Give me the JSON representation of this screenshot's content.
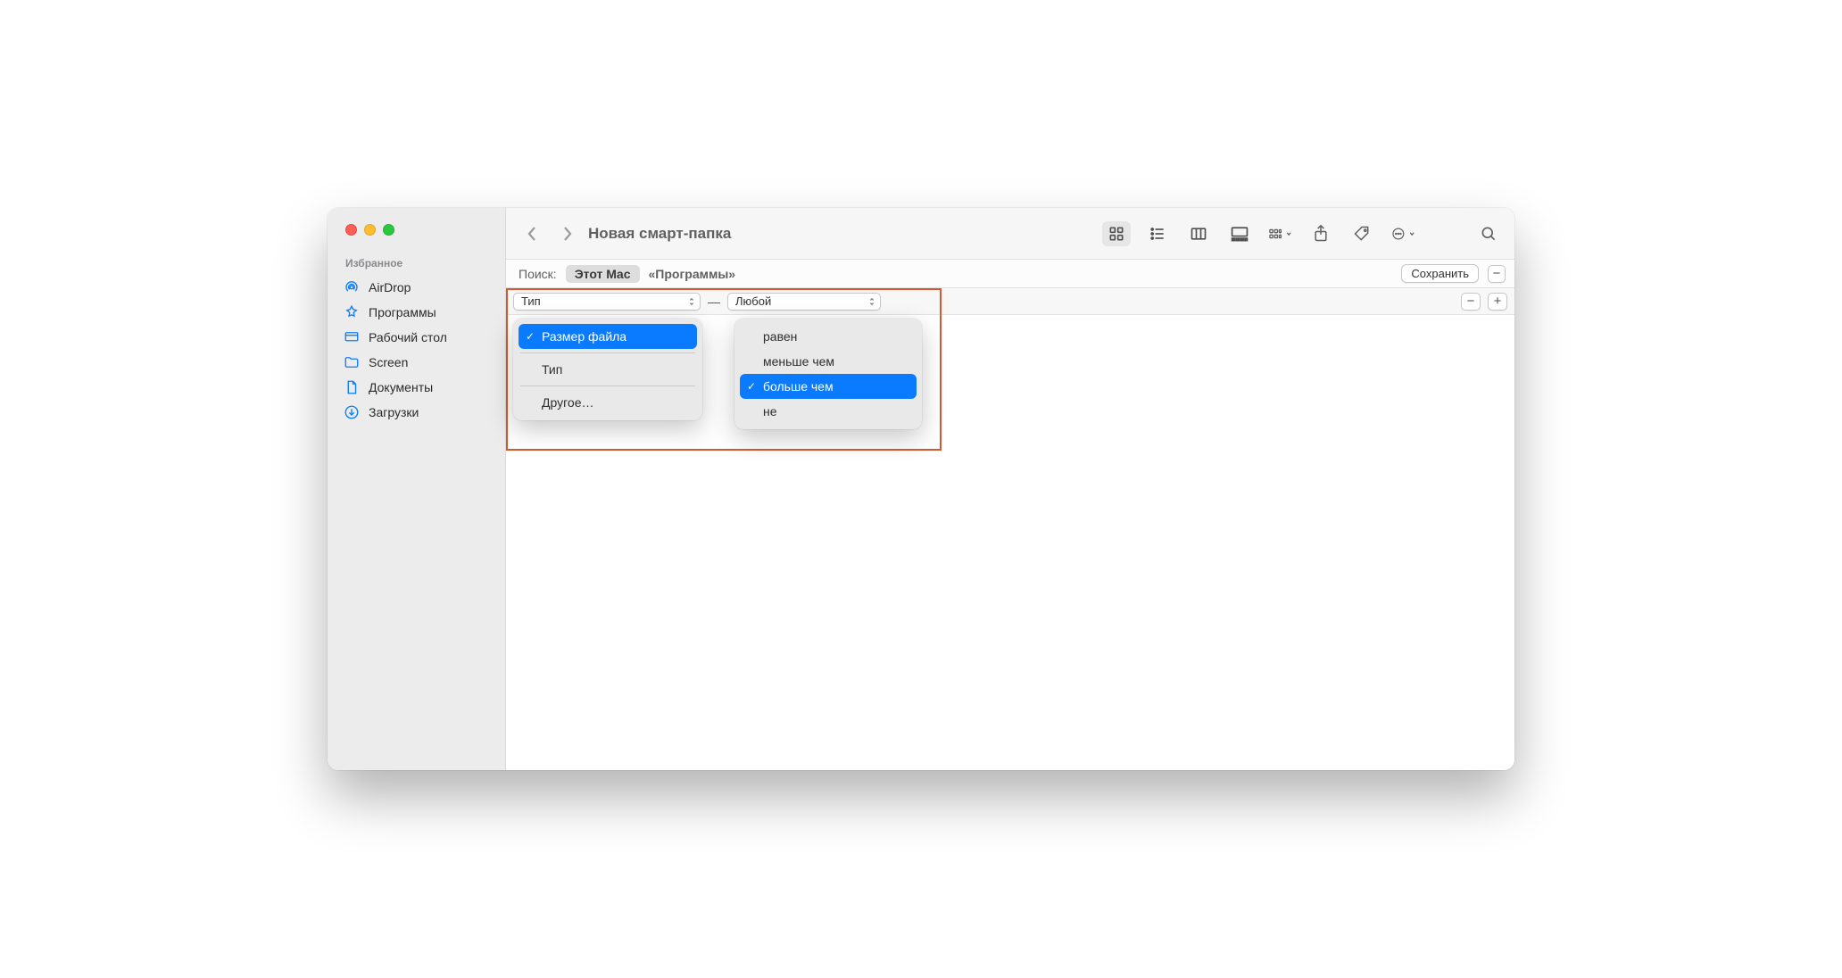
{
  "window": {
    "title": "Новая смарт-папка"
  },
  "sidebar": {
    "section": "Избранное",
    "items": [
      {
        "label": "AirDrop"
      },
      {
        "label": "Программы"
      },
      {
        "label": "Рабочий стол"
      },
      {
        "label": "Screen"
      },
      {
        "label": "Документы"
      },
      {
        "label": "Загрузки"
      }
    ]
  },
  "search": {
    "label": "Поиск:",
    "scope_active": "Этот Mac",
    "scope_alt": "«Программы»",
    "save": "Сохранить",
    "remove_symbol": "−"
  },
  "rule": {
    "kind_value": "Тип",
    "dash": "—",
    "any_value": "Любой",
    "minus": "−",
    "plus": "+"
  },
  "popover_kind": {
    "items": [
      {
        "label": "Размер файла",
        "selected": true
      },
      {
        "label": "Тип",
        "sep_before": true
      },
      {
        "label": "Другое…",
        "sep_before": true
      }
    ]
  },
  "popover_cmp": {
    "items": [
      {
        "label": "равен"
      },
      {
        "label": "меньше чем"
      },
      {
        "label": "больше чем",
        "selected": true
      },
      {
        "label": "не"
      }
    ]
  }
}
